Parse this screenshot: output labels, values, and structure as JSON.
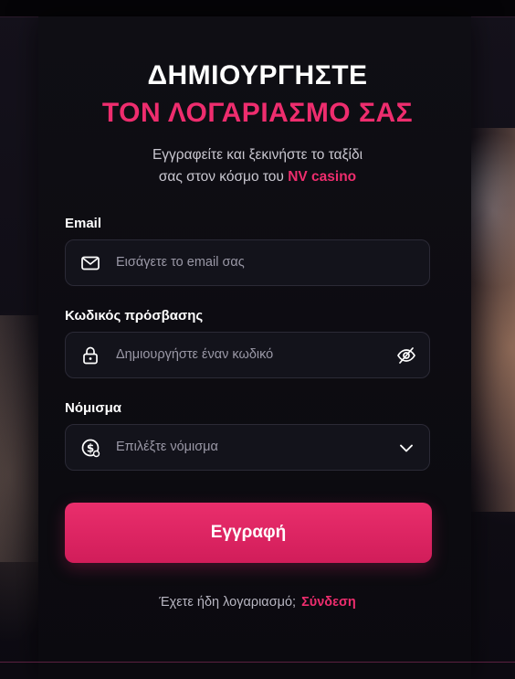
{
  "header": {
    "title_line1": "ΔΗΜΙΟΥΡΓΗΣΤΕ",
    "title_line2": "ΤΟΝ ΛΟΓΑΡΙΑΣΜΟ ΣΑΣ",
    "subtitle_line1": "Εγγραφείτε και ξεκινήστε το ταξίδι",
    "subtitle_line2_prefix": "σας στον κόσμο του ",
    "subtitle_brand": "NV casino"
  },
  "form": {
    "email": {
      "label": "Email",
      "placeholder": "Εισάγετε το email σας",
      "icon": "mail-icon"
    },
    "password": {
      "label": "Κωδικός πρόσβασης",
      "placeholder": "Δημιουργήστε έναν κωδικό",
      "icon": "lock-icon",
      "toggle_icon": "eye-off-icon"
    },
    "currency": {
      "label": "Νόμισμα",
      "placeholder": "Επιλέξτε νόμισμα",
      "icon": "coin-icon",
      "dropdown_icon": "chevron-down-icon"
    },
    "submit_label": "Εγγραφή"
  },
  "footer": {
    "prompt": "Έχετε ήδη λογαριασμό;",
    "login_link": "Σύνδεση"
  },
  "colors": {
    "accent": "#ee2d6e",
    "background": "#0b0a10",
    "field_bg": "#13131b"
  }
}
